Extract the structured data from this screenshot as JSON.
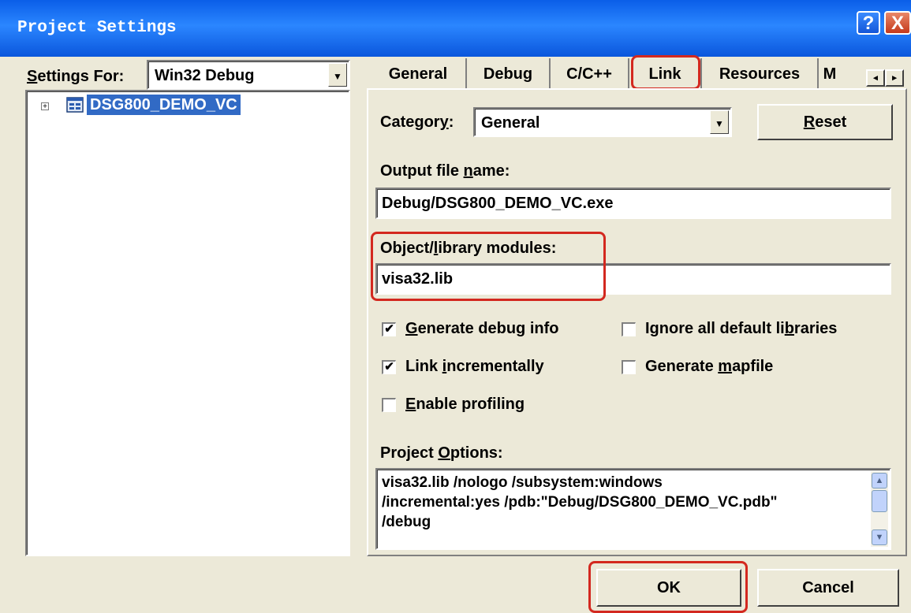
{
  "window": {
    "title": "Project Settings",
    "help_label": "?",
    "close_label": "X"
  },
  "settings_for": {
    "label_prefix": "S",
    "label_rest": "ettings For:",
    "value": "Win32 Debug"
  },
  "tree": {
    "expander": "+",
    "item": "DSG800_DEMO_VC"
  },
  "tabs": [
    {
      "label": "General"
    },
    {
      "label": "Debug"
    },
    {
      "label": "C/C++"
    },
    {
      "label": "Link",
      "selected": true
    },
    {
      "label": "Resources"
    },
    {
      "label": "M"
    }
  ],
  "tab_scroll": {
    "left": "◂",
    "right": "▸"
  },
  "category": {
    "label_a": "Categor",
    "label_u": "y",
    "label_b": ":",
    "value": "General"
  },
  "reset_button": {
    "label_u": "R",
    "label_rest": "eset"
  },
  "output_file": {
    "label_a": "Output file ",
    "label_u": "n",
    "label_b": "ame:",
    "value": "Debug/DSG800_DEMO_VC.exe"
  },
  "object_modules": {
    "label_a": "Object/",
    "label_u": "l",
    "label_b": "ibrary modules:",
    "value": "visa32.lib"
  },
  "checkboxes": {
    "generate_debug": {
      "checked": true,
      "mark": "✔",
      "label_u": "G",
      "label_rest": "enerate debug info"
    },
    "ignore_libs": {
      "checked": false,
      "label_a": "Ignore all default li",
      "label_u": "b",
      "label_b": "raries"
    },
    "link_incrementally": {
      "checked": true,
      "mark": "✔",
      "label_a": "Link ",
      "label_u": "i",
      "label_b": "ncrementally"
    },
    "generate_mapfile": {
      "checked": false,
      "label_a": "Generate ",
      "label_u": "m",
      "label_b": "apfile"
    },
    "enable_profiling": {
      "checked": false,
      "label_u": "E",
      "label_rest": "nable profiling"
    }
  },
  "project_options": {
    "label_a": "Project ",
    "label_u": "O",
    "label_b": "ptions:",
    "text": "visa32.lib /nologo /subsystem:windows\n/incremental:yes /pdb:\"Debug/DSG800_DEMO_VC.pdb\"\n/debug"
  },
  "buttons": {
    "ok": "OK",
    "cancel": "Cancel"
  },
  "colors": {
    "title_blue": "#0a5ee8",
    "selection": "#316ac5",
    "highlight_red": "#d3281f",
    "face": "#ece9d8"
  }
}
